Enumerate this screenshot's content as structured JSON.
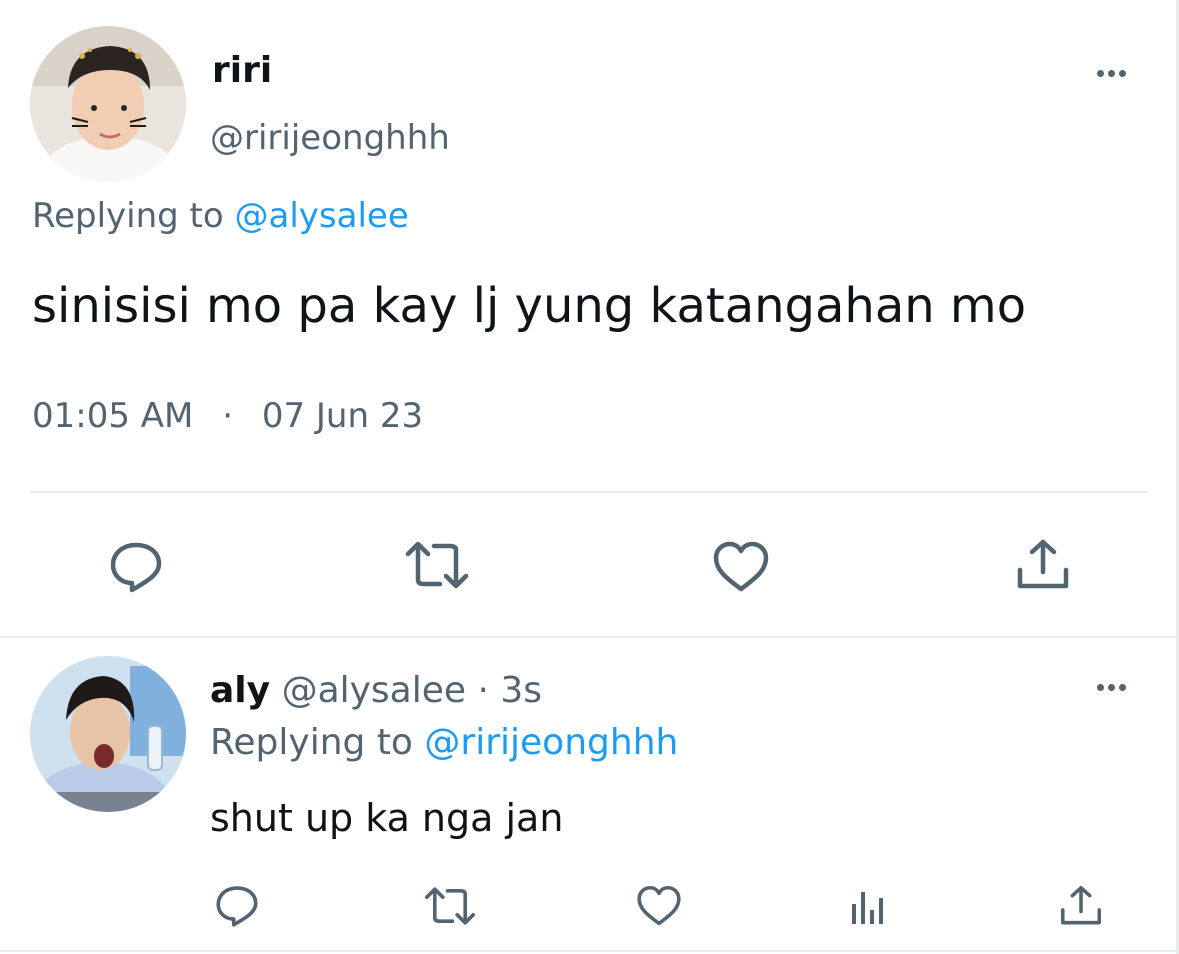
{
  "main_tweet": {
    "author_name": "riri",
    "author_handle": "@ririjeonghhh",
    "replying_label": "Replying to",
    "replying_to": "@alysalee",
    "text": "sinisisi mo pa kay lj yung katangahan mo",
    "time": "01:05 AM",
    "separator": "·",
    "date": "07 Jun 23",
    "actions": [
      "reply-icon",
      "retweet-icon",
      "like-icon",
      "share-icon"
    ]
  },
  "reply_tweet": {
    "author_name": "aly",
    "author_handle": "@alysalee",
    "time_ago": "· 3s",
    "replying_label": "Replying to",
    "replying_to": "@ririjeonghhh",
    "text": "shut up ka nga jan",
    "actions": [
      "reply-icon",
      "retweet-icon",
      "like-icon",
      "views-icon",
      "share-icon"
    ]
  },
  "colors": {
    "text": "#0f1419",
    "muted": "#536471",
    "link": "#1d9bf0",
    "divider": "#e6ecf0"
  }
}
